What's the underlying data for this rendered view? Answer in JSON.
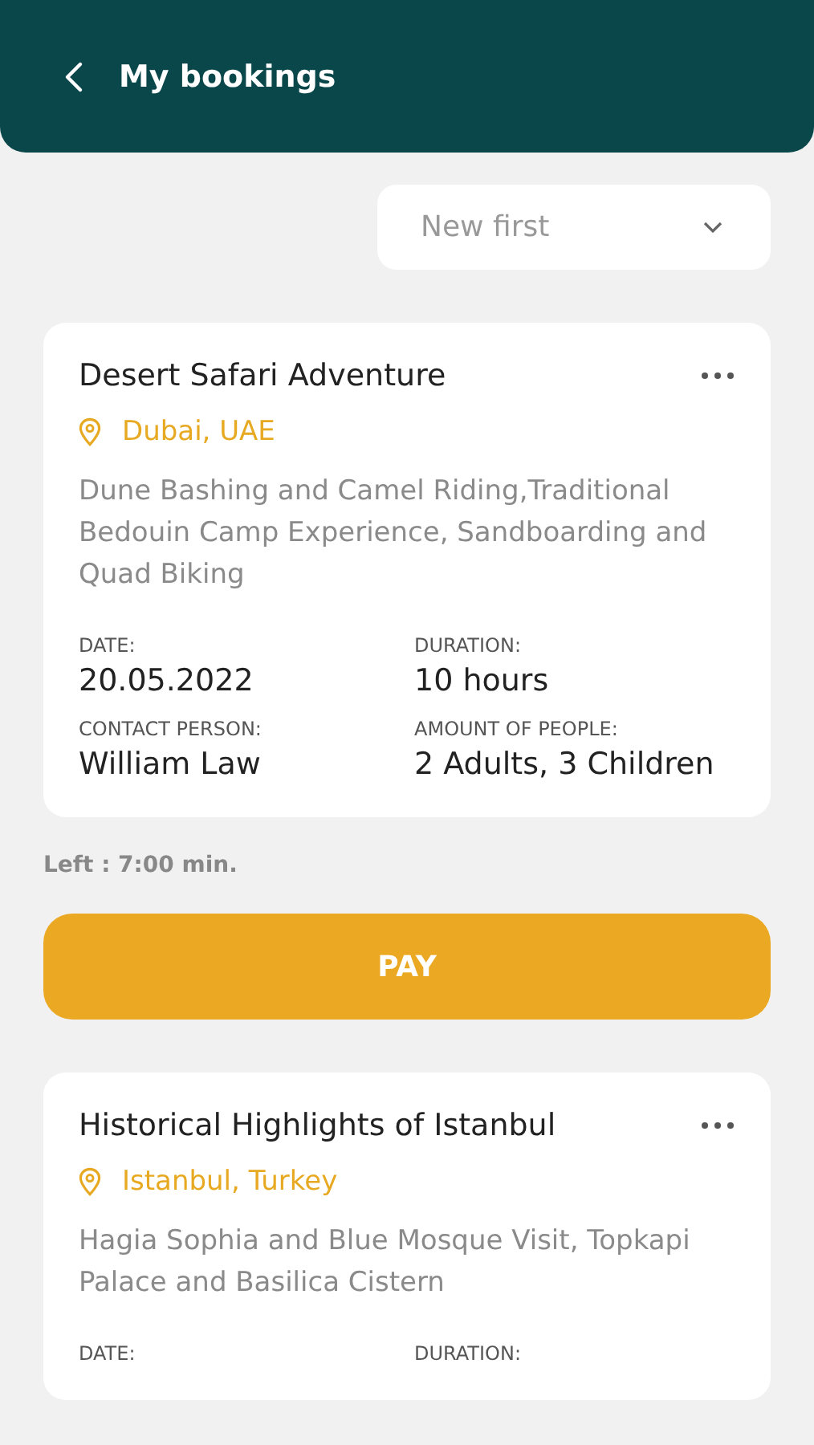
{
  "header": {
    "title": "My bookings"
  },
  "sort": {
    "value": "New first"
  },
  "bookings": [
    {
      "title": "Desert Safari Adventure",
      "location": "Dubai, UAE",
      "description": "Dune Bashing and Camel Riding,Traditional Bedouin Camp Experience, Sandboarding and Quad Biking",
      "fields": [
        {
          "label": "DATE:",
          "value": "20.05.2022"
        },
        {
          "label": "DURATION:",
          "value": "10 hours"
        },
        {
          "label": "CONTACT PERSON:",
          "value": "William Law"
        },
        {
          "label": "AMOUNT OF PEOPLE:",
          "value": "2 Adults, 3 Children"
        }
      ],
      "time_left": "Left : 7:00 min.",
      "action": "PAY"
    },
    {
      "title": "Historical Highlights of Istanbul",
      "location": "Istanbul, Turkey",
      "description": "Hagia Sophia and Blue Mosque Visit, Topkapi Palace and Basilica Cistern",
      "fields": [
        {
          "label": "DATE:"
        },
        {
          "label": "DURATION:"
        }
      ]
    }
  ]
}
